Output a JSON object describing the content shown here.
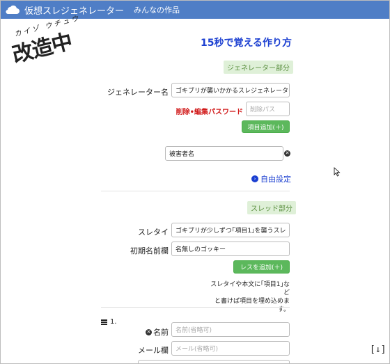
{
  "navbar": {
    "brand": "仮想スレジェネレーター",
    "works_link": "みんなの作品"
  },
  "stamp": {
    "ruby": "カイゾ ウチュウ",
    "main": "改造中"
  },
  "guide_link": "15秒で覚える作り方",
  "generator": {
    "section_label": "ジェネレーター部分",
    "name_label": "ジェネレーター名",
    "name_value": "ゴキブリが襲いかかるスレジェネレーター",
    "password_label": "削除•編集パスワード",
    "password_placeholder": "削除パス",
    "add_item_button": "項目追加(＋)",
    "item_value": "被害者名",
    "free_settings_link": "自由設定"
  },
  "thread": {
    "section_label": "スレッド部分",
    "title_label": "スレタイ",
    "title_value": "ゴキブリが少しずつ｢項目1｣を襲うスレ",
    "default_name_label": "初期名前欄",
    "default_name_value": "名無しのゴッキー",
    "add_res_button": "レスを追加(＋)",
    "note_line1": "スレタイや本文に｢項目1｣など",
    "note_line2": "と書けば項目を埋め込めます。"
  },
  "res1": {
    "number": "1.",
    "name_label": "名前",
    "name_placeholder": "名前(省略可)",
    "mail_label": "メール欄",
    "mail_placeholder": "メール(省略可)"
  },
  "scroll_down_button": "[↓]"
}
